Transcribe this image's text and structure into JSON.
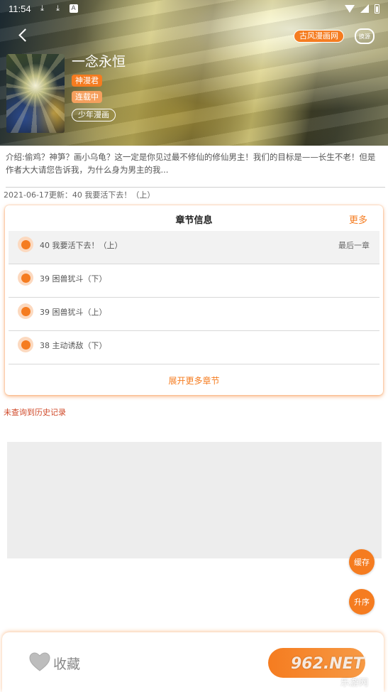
{
  "status_bar": {
    "time": "11:54",
    "icons": [
      "download-icon",
      "download-icon",
      "notification-a-icon",
      "wifi-icon",
      "signal-icon",
      "battery-icon"
    ],
    "a_glyph": "A"
  },
  "header": {
    "title": "一念永恒",
    "source_badge": "古风漫画网",
    "switch_label": "换源",
    "author": "神漫君",
    "status": "连载中",
    "genre": "少年漫画"
  },
  "intro": "介绍:偷鸡？神笋？画小乌龟？这一定是你见过最不修仙的修仙男主！我们的目标是——长生不老！但是作者大大请您告诉我，为什么身为男主的我...",
  "update_line": "2021-06-17更新：40 我要活下去！（上）",
  "chapter_card": {
    "title": "章节信息",
    "more_label": "更多",
    "chapters": [
      {
        "name": "40 我要活下去！（上）",
        "tag": "最后一章"
      },
      {
        "name": "39 困兽犹斗（下）",
        "tag": ""
      },
      {
        "name": "39 困兽犹斗（上）",
        "tag": ""
      },
      {
        "name": "38 主动诱敌（下）",
        "tag": ""
      }
    ],
    "expand_label": "展开更多章节"
  },
  "history_text": "未查询到历史记录",
  "fabs": {
    "cache_label": "缓存",
    "sort_label": "升序"
  },
  "bottom_bar": {
    "favorite_label": "收藏"
  },
  "watermark": {
    "main": "962.NET",
    "sub": "乐游网"
  },
  "colors": {
    "accent": "#f57c20",
    "accent_light": "#f5a05e",
    "history_red": "#d04a2a"
  }
}
